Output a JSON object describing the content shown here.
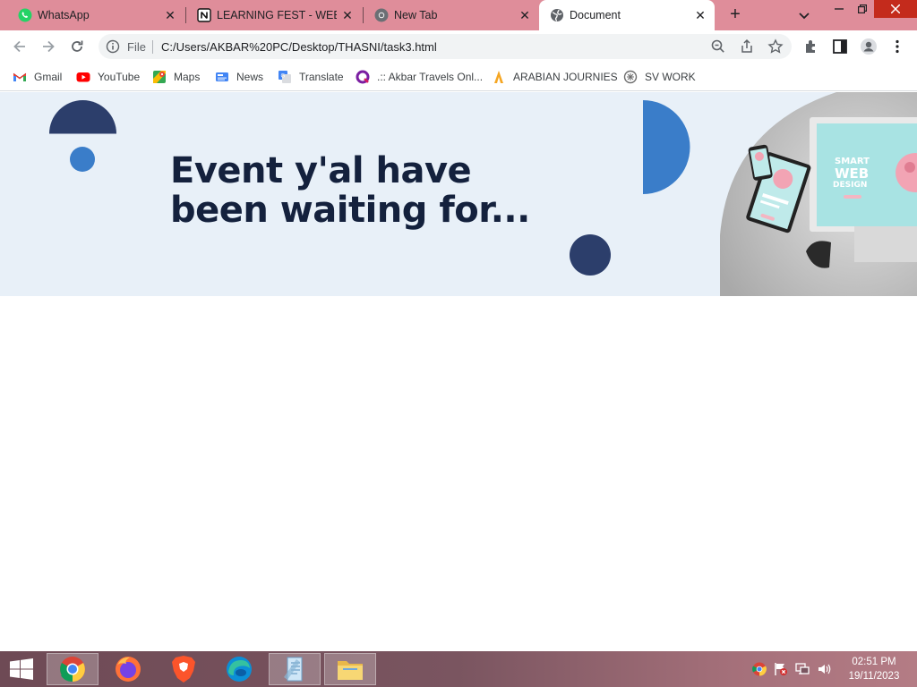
{
  "browser": {
    "tabs": [
      {
        "title": "WhatsApp",
        "icon": "whatsapp-icon",
        "active": false
      },
      {
        "title": "LEARNING FEST - WEB D",
        "icon": "notion-icon",
        "active": false
      },
      {
        "title": "New Tab",
        "icon": "chrome-icon",
        "active": false
      },
      {
        "title": "Document",
        "icon": "globe-icon",
        "active": true
      }
    ],
    "address_bar": {
      "scheme_label": "File",
      "url": "C:/Users/AKBAR%20PC/Desktop/THASNI/task3.html"
    },
    "bookmarks": [
      {
        "label": "Gmail",
        "icon": "gmail-icon"
      },
      {
        "label": "YouTube",
        "icon": "youtube-icon"
      },
      {
        "label": "Maps",
        "icon": "maps-icon"
      },
      {
        "label": "News",
        "icon": "news-icon"
      },
      {
        "label": "Translate",
        "icon": "translate-icon"
      },
      {
        "label": ".:: Akbar Travels Onl...",
        "icon": "akbar-travels-icon"
      },
      {
        "label": "ARABIAN JOURNIES",
        "icon": "arabian-journies-icon"
      },
      {
        "label": "SV WORK",
        "icon": "sv-work-icon"
      }
    ]
  },
  "page": {
    "headline_line1": "Event y'al have",
    "headline_line2": "been waiting for...",
    "hero_image": {
      "screen_text_1": "SMART",
      "screen_text_2": "WEB",
      "screen_text_3": "DESIGN"
    },
    "colors": {
      "navy": "#2c3e6b",
      "blue": "#3a7dc9",
      "headline": "#14213d",
      "banner_bg": "#e8f0f8"
    }
  },
  "taskbar": {
    "apps": [
      {
        "name": "Google Chrome",
        "icon": "chrome-icon",
        "active": true
      },
      {
        "name": "Firefox",
        "icon": "firefox-icon",
        "active": false
      },
      {
        "name": "Brave",
        "icon": "brave-icon",
        "active": false
      },
      {
        "name": "Microsoft Edge",
        "icon": "edge-icon",
        "active": false
      },
      {
        "name": "Notepad",
        "icon": "notepad-icon",
        "active": true
      },
      {
        "name": "File Explorer",
        "icon": "folder-icon",
        "active": true
      }
    ],
    "clock": {
      "time": "02:51 PM",
      "date": "19/11/2023"
    }
  }
}
